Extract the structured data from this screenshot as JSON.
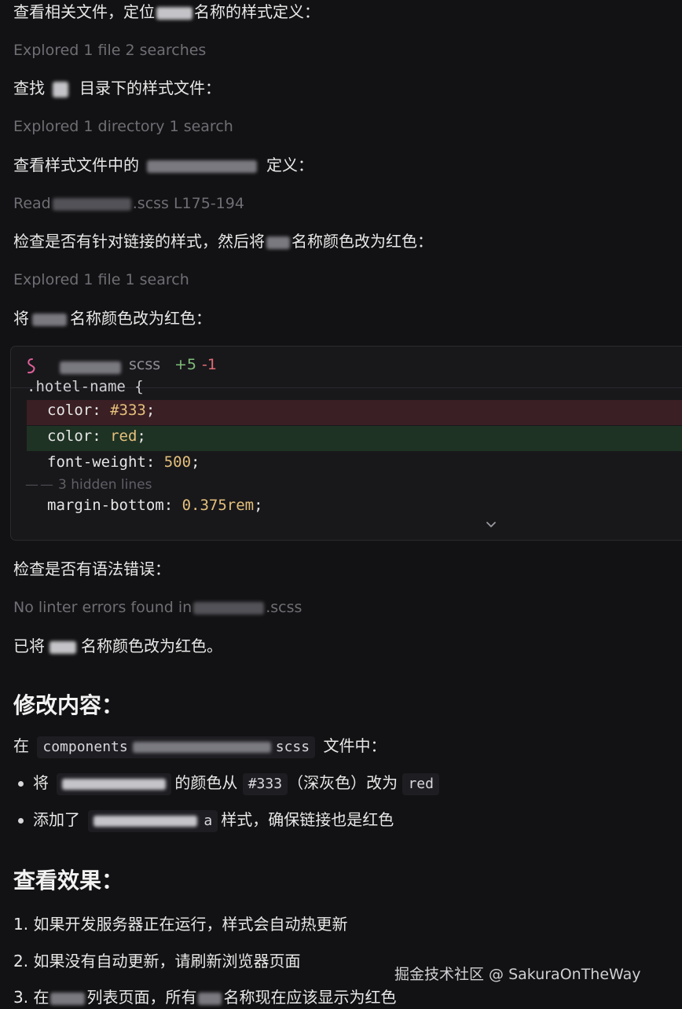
{
  "steps": [
    {
      "id": "s1",
      "text_a": "查看相关文件，定位",
      "text_b": "名称的样式定义："
    },
    {
      "id": "s2",
      "status": "Explored 1 file 2 searches"
    },
    {
      "id": "s3",
      "text_a": "查找",
      "text_b": "目录下的样式文件："
    },
    {
      "id": "s4",
      "status": "Explored 1 directory 1 search"
    },
    {
      "id": "s5",
      "text_a": "查看样式文件中的",
      "text_b": "定义："
    },
    {
      "id": "s6",
      "status_a": "Read",
      "status_b": ".scss L175-194"
    },
    {
      "id": "s7",
      "text_a": "检查是否有针对链接的样式，然后将",
      "text_b": "名称颜色改为红色："
    },
    {
      "id": "s8",
      "status": "Explored 1 file 1 search"
    },
    {
      "id": "s9",
      "text_a": "将",
      "text_b": "名称颜色改为红色："
    }
  ],
  "diff": {
    "ext": "scss",
    "added": "+5",
    "removed": "-1",
    "selector_partial": ".hotel-name {",
    "removed_line": {
      "prop": "color: ",
      "value": "#333",
      "end": ";"
    },
    "added_line": {
      "prop": "color: ",
      "value": "red",
      "end": ";"
    },
    "weight_line": {
      "prop": "font-weight: ",
      "value": "500",
      "end": ";"
    },
    "hidden": "3 hidden lines",
    "margin_line": {
      "prop": "margin-bottom: ",
      "value": "0.375rem",
      "end": ";"
    }
  },
  "after": {
    "check": "检查是否有语法错误：",
    "lint_a": "No linter errors found in",
    "lint_b": ".scss",
    "done_a": "已将",
    "done_b": "名称颜色改为红色。"
  },
  "changes": {
    "heading": "修改内容：",
    "file_prefix": "在",
    "file_code_a": "components",
    "file_code_b": "scss",
    "file_suffix": "文件中：",
    "bullet1_a": "将",
    "bullet1_b": "的颜色从",
    "bullet1_code1": "#333",
    "bullet1_c": "（深灰色）改为",
    "bullet1_code2": "red",
    "bullet2_a": "添加了",
    "bullet2_code": "a",
    "bullet2_b": "样式，确保链接也是红色"
  },
  "effect": {
    "heading": "查看效果：",
    "item1": "1. 如果开发服务器正在运行，样式会自动热更新",
    "item2": "2. 如果没有自动更新，请刷新浏览器页面",
    "item3_a": "3. 在",
    "item3_b": "列表页面，所有",
    "item3_c": "名称现在应该显示为红色"
  },
  "watermark": "掘金技术社区 @ SakuraOnTheWay",
  "colors": {
    "background": "#121214",
    "diff_removed": "#3a1f24",
    "diff_added": "#1f3324",
    "added_count": "#7fbf7a",
    "removed_count": "#e06c75",
    "code_value": "#e5c07b"
  }
}
